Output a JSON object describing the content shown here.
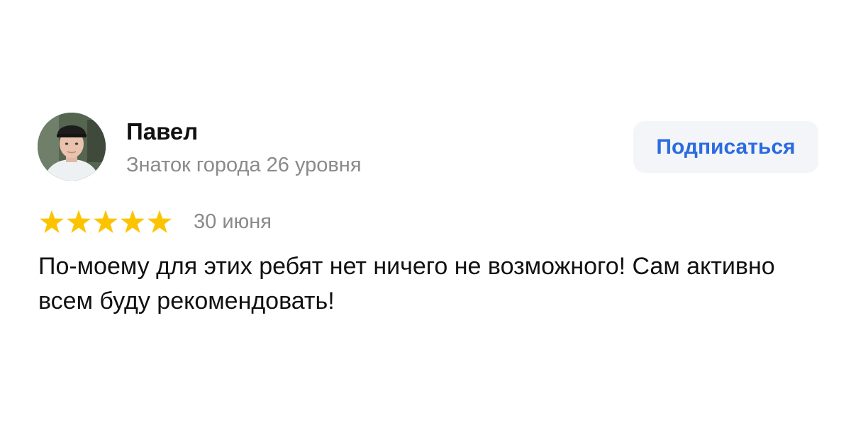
{
  "review": {
    "author": {
      "name": "Павел",
      "level": "Знаток города 26 уровня"
    },
    "subscribe_label": "Подписаться",
    "rating": 5,
    "rating_max": 5,
    "date": "30 июня",
    "text": "По-моему для этих ребят нет ничего не возможного! Сам активно всем буду рекомендовать!"
  },
  "colors": {
    "star": "#fcc400",
    "accent": "#2a6be0",
    "button_bg": "#f3f5f8",
    "muted_text": "#8a8a8a",
    "text": "#111111"
  },
  "icons": {
    "star": "star-icon",
    "avatar": "avatar"
  }
}
